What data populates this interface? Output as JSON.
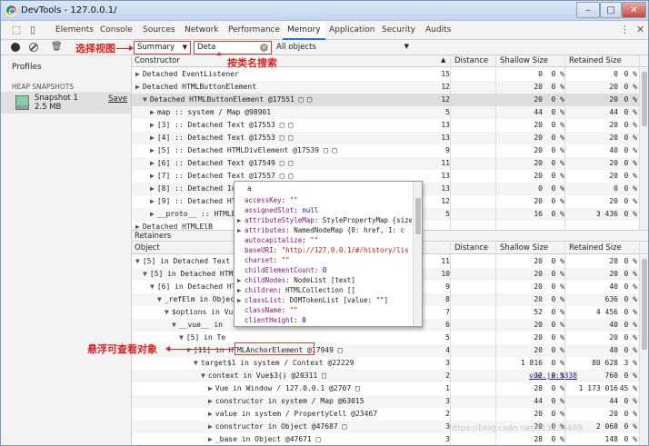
{
  "window": {
    "title": "DevTools - 127.0.0.1/"
  },
  "devtools": {
    "tabs": [
      "Elements",
      "Console",
      "Sources",
      "Network",
      "Performance",
      "Memory",
      "Application",
      "Security",
      "Audits"
    ],
    "active_tab": "Memory"
  },
  "toolbar": {
    "view_select": "Summary",
    "filter_value": "Deta",
    "class_filter": "All objects"
  },
  "annotations": {
    "select_view": "选择视图",
    "search_class": "按类名搜索",
    "hover_view": "悬浮可查看对象"
  },
  "sidebar": {
    "profiles": "Profiles",
    "heap_snapshots": "HEAP SNAPSHOTS",
    "snapshot_name": "Snapshot 1",
    "snapshot_size": "2.5 MB",
    "save": "Save"
  },
  "table": {
    "headers": {
      "constructor": "Constructor",
      "distance": "Distance",
      "shallow": "Shallow Size",
      "retained": "Retained Size"
    },
    "rows": [
      {
        "indent": 0,
        "tri": "▶",
        "text": "Detached EventListener",
        "d": "15",
        "s": "0",
        "sp": "0 %",
        "r": "0",
        "rp": "0 %"
      },
      {
        "indent": 0,
        "tri": "▶",
        "text": "Detached HTMLButtonElement",
        "d": "12",
        "s": "20",
        "sp": "0 %",
        "r": "20",
        "rp": "0 %"
      },
      {
        "indent": 1,
        "tri": "▼",
        "text": "Detached HTMLButtonElement @17551 □ □",
        "d": "12",
        "s": "20",
        "sp": "0 %",
        "r": "20",
        "rp": "0 %"
      },
      {
        "indent": 2,
        "tri": "▶",
        "text": "map :: system / Map @98901",
        "d": "5",
        "s": "44",
        "sp": "0 %",
        "r": "44",
        "rp": "0 %"
      },
      {
        "indent": 2,
        "tri": "▶",
        "text": "[3] :: Detached Text @17553 □ □",
        "d": "13",
        "s": "20",
        "sp": "0 %",
        "r": "20",
        "rp": "0 %"
      },
      {
        "indent": 2,
        "tri": "▶",
        "text": "[4] :: Detached Text @17553 □ □",
        "d": "13",
        "s": "20",
        "sp": "0 %",
        "r": "20",
        "rp": "0 %"
      },
      {
        "indent": 2,
        "tri": "▶",
        "text": "[5] :: Detached HTMLDivElement @17539 □ □",
        "d": "9",
        "s": "20",
        "sp": "0 %",
        "r": "40",
        "rp": "0 %"
      },
      {
        "indent": 2,
        "tri": "▶",
        "text": "[6] :: Detached Text @17549 □ □",
        "d": "11",
        "s": "20",
        "sp": "0 %",
        "r": "20",
        "rp": "0 %"
      },
      {
        "indent": 2,
        "tri": "▶",
        "text": "[7] :: Detached Text @17557 □ □",
        "d": "13",
        "s": "20",
        "sp": "0 %",
        "r": "20",
        "rp": "0 %"
      },
      {
        "indent": 2,
        "tri": "▶",
        "text": "[8] :: Detached In",
        "d": "13",
        "s": "0",
        "sp": "0 %",
        "r": "0",
        "rp": "0 %"
      },
      {
        "indent": 2,
        "tri": "▶",
        "text": "[9] :: Detached HT",
        "d": "12",
        "s": "20",
        "sp": "0 %",
        "r": "20",
        "rp": "0 %"
      },
      {
        "indent": 2,
        "tri": "▶",
        "text": "__proto__ :: HTMLB",
        "d": "5",
        "s": "16",
        "sp": "0 %",
        "r": "3 436",
        "rp": "0 %"
      },
      {
        "indent": 0,
        "tri": "▶",
        "text": "Detached HTMLElB",
        "d": "",
        "s": "",
        "sp": "",
        "r": "",
        "rp": ""
      }
    ]
  },
  "retainers": {
    "section_title": "Retainers",
    "headers": {
      "object": "Object",
      "distance": "Distance",
      "shallow": "Shallow Size",
      "retained": "Retained Size"
    },
    "rows": [
      {
        "indent": 0,
        "tri": "▼",
        "text": "[5] in Detached Text @",
        "d": "11",
        "s": "20",
        "sp": "0 %",
        "r": "20",
        "rp": "0 %"
      },
      {
        "indent": 1,
        "tri": "▼",
        "text": "[5] in Detached HTML",
        "d": "10",
        "s": "20",
        "sp": "0 %",
        "r": "20",
        "rp": "0 %"
      },
      {
        "indent": 2,
        "tri": "▼",
        "text": "[6] in Detached HT",
        "d": "9",
        "s": "20",
        "sp": "0 %",
        "r": "40",
        "rp": "0 %"
      },
      {
        "indent": 3,
        "tri": "▼",
        "text": "_refElm in Object",
        "d": "8",
        "s": "20",
        "sp": "0 %",
        "r": "636",
        "rp": "0 %"
      },
      {
        "indent": 4,
        "tri": "▼",
        "text": "$options in Vu",
        "d": "7",
        "s": "52",
        "sp": "0 %",
        "r": "4 456",
        "rp": "0 %"
      },
      {
        "indent": 5,
        "tri": "▼",
        "text": "__vue__ in",
        "d": "6",
        "s": "20",
        "sp": "0 %",
        "r": "40",
        "rp": "0 %"
      },
      {
        "indent": 6,
        "tri": "▼",
        "text": "[5] in Te",
        "d": "5",
        "s": "20",
        "sp": "0 %",
        "r": "20",
        "rp": "0 %"
      },
      {
        "indent": 7,
        "tri": "▼",
        "text": "[11] in HTMLAnchorElement @17949 □",
        "d": "4",
        "s": "20",
        "sp": "0 %",
        "r": "40",
        "rp": "0 %"
      },
      {
        "indent": 8,
        "tri": "▼",
        "text": "target$1 in system / Context @22229",
        "d": "3",
        "s": "1 816",
        "sp": "0 %",
        "r": "80 628",
        "rp": "3 %"
      },
      {
        "indent": 9,
        "tri": "▼",
        "text": "context in Vue$3() @20311 □",
        "d": "2",
        "s": "32",
        "sp": "0 %",
        "r": "760",
        "rp": "0 %",
        "src": "vue.js:3838"
      },
      {
        "indent": 10,
        "tri": "▶",
        "text": "Vue in Window / 127.0.0.1 @2707 □",
        "d": "1",
        "s": "28",
        "sp": "0 %",
        "r": "1 173 016",
        "rp": "45 %"
      },
      {
        "indent": 10,
        "tri": "▶",
        "text": "constructor in system / Map @63015",
        "d": "3",
        "s": "44",
        "sp": "0 %",
        "r": "44",
        "rp": "0 %"
      },
      {
        "indent": 10,
        "tri": "▶",
        "text": "value in system / PropertyCell @23467",
        "d": "2",
        "s": "20",
        "sp": "0 %",
        "r": "20",
        "rp": "0 %"
      },
      {
        "indent": 10,
        "tri": "▶",
        "text": "constructor in Object @47687 □",
        "d": "3",
        "s": "20",
        "sp": "0 %",
        "r": "2 068",
        "rp": "0 %"
      },
      {
        "indent": 10,
        "tri": "▶",
        "text": "_base in Object @47671 □",
        "d": "3",
        "s": "28",
        "sp": "0 %",
        "r": "148",
        "rp": "0 %"
      }
    ]
  },
  "popup": {
    "header": "a",
    "props": [
      {
        "tri": "",
        "key": "accessKey",
        "val": "\"\"",
        "type": "s"
      },
      {
        "tri": "",
        "key": "assignedSlot",
        "val": "null",
        "type": "n"
      },
      {
        "tri": "▶",
        "key": "attributeStyleMap",
        "val": "StylePropertyMap {size",
        "type": "o"
      },
      {
        "tri": "▶",
        "key": "attributes",
        "val": "NamedNodeMap {0: href, 1: c",
        "type": "o"
      },
      {
        "tri": "",
        "key": "autocapitalize",
        "val": "\"\"",
        "type": "s"
      },
      {
        "tri": "",
        "key": "baseURI",
        "val": "\"http://127.0.0.1/#/history/lis",
        "type": "s"
      },
      {
        "tri": "",
        "key": "charset",
        "val": "\"\"",
        "type": "s"
      },
      {
        "tri": "",
        "key": "childElementCount",
        "val": "0",
        "type": "n"
      },
      {
        "tri": "▶",
        "key": "childNodes",
        "val": "NodeList [text]",
        "type": "o"
      },
      {
        "tri": "▶",
        "key": "children",
        "val": "HTMLCollection []",
        "type": "o"
      },
      {
        "tri": "▶",
        "key": "classList",
        "val": "DOMTokenList [value: \"\"]",
        "type": "o"
      },
      {
        "tri": "",
        "key": "className",
        "val": "\"\"",
        "type": "s"
      },
      {
        "tri": "",
        "key": "clientHeight",
        "val": "0",
        "type": "n"
      }
    ]
  },
  "watermark": "https://blog.csdn.net/c13133499"
}
